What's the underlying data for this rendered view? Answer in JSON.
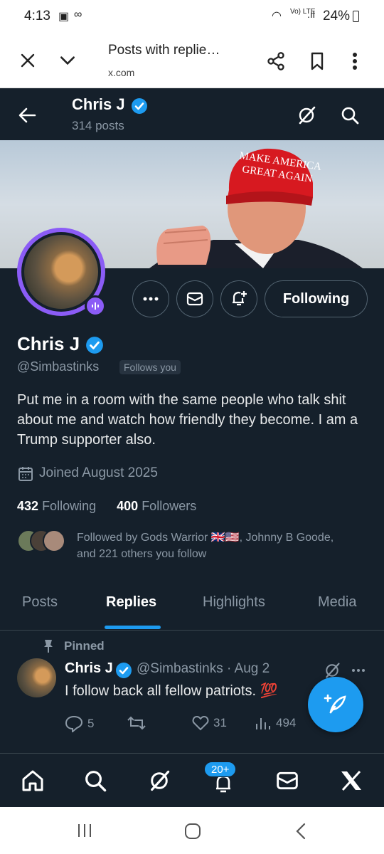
{
  "status": {
    "time": "4:13",
    "battery": "24%",
    "network": "Vo) LTE"
  },
  "browser": {
    "title": "Posts with replie…",
    "url": "x.com"
  },
  "header": {
    "name": "Chris J",
    "posts": "314 posts"
  },
  "banner": {
    "hat_line1": "MAKE AMERICA",
    "hat_line2": "GREAT AGAIN"
  },
  "profile": {
    "name": "Chris J",
    "handle": "@Simbastinks",
    "follows_you": "Follows you",
    "following_button": "Following",
    "bio": "Put me in a room with the same people who talk shit about me and watch how friendly they become. I am a Trump supporter also.",
    "joined": "Joined August 2025",
    "following_count": "432",
    "following_label": "Following",
    "followers_count": "400",
    "followers_label": "Followers",
    "followed_by": "Followed by Gods Warrior 🇬🇧🇺🇸, Johnny B Goode, and 221 others you follow"
  },
  "tabs": [
    "Posts",
    "Replies",
    "Highlights",
    "Media"
  ],
  "post": {
    "pinned": "Pinned",
    "name": "Chris J",
    "meta": "@Simbastinks · Aug 2",
    "text": "I follow back all fellow patriots. 💯",
    "replies": "5",
    "likes": "31",
    "views": "494"
  },
  "nav": {
    "notif_badge": "20+"
  },
  "colors": {
    "accent": "#1d9bf0",
    "background": "#15202b",
    "avatar_ring": "#8b5cf6"
  }
}
